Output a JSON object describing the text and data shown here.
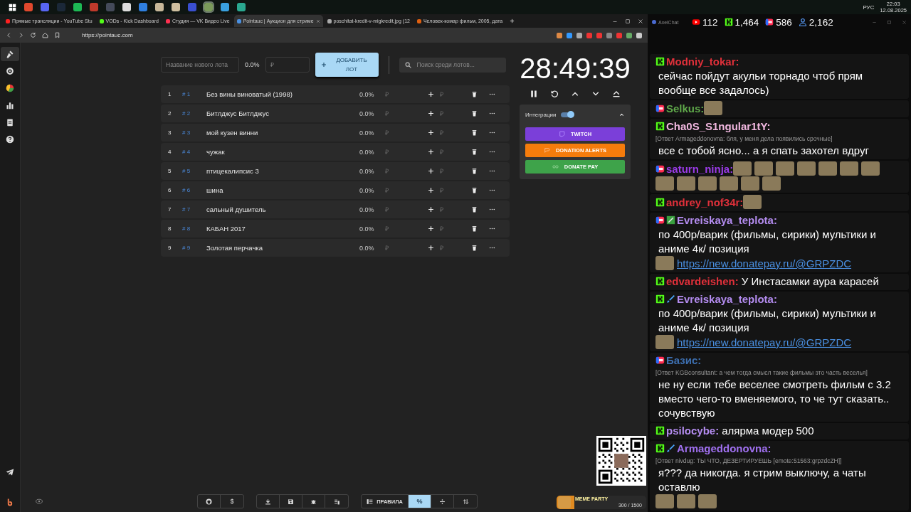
{
  "taskbar": {
    "apps": [
      {
        "color": "#e0482d",
        "selected": false
      },
      {
        "color": "#5865f2",
        "selected": false
      },
      {
        "color": "#1b2838",
        "selected": false
      },
      {
        "color": "#1db954",
        "selected": false
      },
      {
        "color": "#c0392b",
        "selected": false
      },
      {
        "color": "#444a5a",
        "selected": false
      },
      {
        "color": "#dddddd",
        "selected": false
      },
      {
        "color": "#2f7fe0",
        "selected": false
      },
      {
        "color": "#c8b89a",
        "selected": false
      },
      {
        "color": "#d0c0a0",
        "selected": false
      },
      {
        "color": "#3a4fd0",
        "selected": false
      },
      {
        "color": "#7a9a5a",
        "selected": true
      },
      {
        "color": "#3aa0e0",
        "selected": false
      },
      {
        "color": "#2aa890",
        "selected": false
      }
    ],
    "tray": {
      "language": "РУС",
      "time": "22:03",
      "date": "12.08.2025"
    }
  },
  "browser": {
    "tabs": [
      {
        "title": "Прямые трансляции - YouTube Stu",
        "color": "#ff2020",
        "selected": false
      },
      {
        "title": "VODs - Kick Dashboard",
        "color": "#53fc18",
        "selected": false
      },
      {
        "title": "Студия — VK Видео Live",
        "color": "#ff3050",
        "selected": false
      },
      {
        "title": "Pointauc | Аукцион для стриме",
        "color": "#4a90e2",
        "selected": true
      },
      {
        "title": "poschitat-kredit-v-migkredit.jpg (12",
        "color": "#aaaaaa",
        "selected": false
      },
      {
        "title": "Человек-комар фильм, 2005, дата",
        "color": "#e06010",
        "selected": false
      }
    ],
    "url": "https://pointauc.com"
  },
  "sidebar": {
    "items": [
      {
        "kind": "gavel",
        "selected": true
      },
      {
        "kind": "gear",
        "selected": false
      },
      {
        "kind": "pie",
        "selected": false
      },
      {
        "kind": "bars",
        "selected": false
      },
      {
        "kind": "clipboard",
        "selected": false
      },
      {
        "kind": "help",
        "selected": false
      }
    ],
    "bottom": [
      {
        "kind": "plane"
      },
      {
        "kind": "logo"
      }
    ]
  },
  "form": {
    "name_placeholder": "Название нового лота",
    "percent": "0.0%",
    "amount_placeholder": "₽",
    "add_button": "ДОБАВИТЬ ЛОТ",
    "search_placeholder": "Поиск среди лотов..."
  },
  "lots": [
    {
      "index": "1",
      "number": "# 1",
      "name": "Без вины виноватый (1998)",
      "percent": "0.0%",
      "amount_placeholder": "₽",
      "add_placeholder": "₽"
    },
    {
      "index": "2",
      "number": "# 2",
      "name": "Битлджус Битлджус",
      "percent": "0.0%",
      "amount_placeholder": "₽",
      "add_placeholder": "₽"
    },
    {
      "index": "3",
      "number": "# 3",
      "name": "мой кузен винни",
      "percent": "0.0%",
      "amount_placeholder": "₽",
      "add_placeholder": "₽"
    },
    {
      "index": "4",
      "number": "# 4",
      "name": "чужак",
      "percent": "0.0%",
      "amount_placeholder": "₽",
      "add_placeholder": "₽"
    },
    {
      "index": "5",
      "number": "# 5",
      "name": "птицекалипсис 3",
      "percent": "0.0%",
      "amount_placeholder": "₽",
      "add_placeholder": "₽"
    },
    {
      "index": "6",
      "number": "# 6",
      "name": "шина",
      "percent": "0.0%",
      "amount_placeholder": "₽",
      "add_placeholder": "₽"
    },
    {
      "index": "7",
      "number": "# 7",
      "name": "сальный душитель",
      "percent": "0.0%",
      "amount_placeholder": "₽",
      "add_placeholder": "₽"
    },
    {
      "index": "8",
      "number": "# 8",
      "name": "КАБАН 2017",
      "percent": "0.0%",
      "amount_placeholder": "₽",
      "add_placeholder": "₽"
    },
    {
      "index": "9",
      "number": "# 9",
      "name": "Золотая перчачка",
      "percent": "0.0%",
      "amount_placeholder": "₽",
      "add_placeholder": "₽"
    }
  ],
  "timer": {
    "time": "28:49:39",
    "controls": [
      {
        "kind": "pause"
      },
      {
        "kind": "restart"
      },
      {
        "kind": "up"
      },
      {
        "kind": "down"
      },
      {
        "kind": "eject"
      }
    ]
  },
  "integrations": {
    "label": "Интеграции",
    "on": true,
    "expanded": true,
    "buttons": [
      {
        "kind": "twitch",
        "label": "TWITCH",
        "color": "#7b3fd9"
      },
      {
        "kind": "alerts",
        "label": "DONATION ALERTS",
        "color": "#f57c0c"
      },
      {
        "kind": "donatepay",
        "label": "DONATE PAY",
        "color": "#3ea34a"
      }
    ]
  },
  "toolbar": {
    "groups": [
      [
        {
          "kind": "github",
          "selected": false
        },
        {
          "kind": "text",
          "label": "$",
          "selected": false
        }
      ],
      [
        {
          "kind": "download",
          "selected": false
        },
        {
          "kind": "save",
          "selected": false
        },
        {
          "kind": "bug",
          "selected": false
        },
        {
          "kind": "clear",
          "selected": false
        }
      ],
      [
        {
          "kind": "rules",
          "label": "ПРАВИЛА",
          "selected": false
        },
        {
          "kind": "text",
          "label": "%",
          "selected": true
        },
        {
          "kind": "divide",
          "selected": false
        },
        {
          "kind": "sort",
          "selected": false
        }
      ]
    ]
  },
  "overlay": {
    "meme_party": {
      "title": "MEME PARTY",
      "progress": "300 / 1500",
      "level": 0.2
    }
  },
  "chat": {
    "title": "AxelChat",
    "stats": [
      {
        "kind": "youtube",
        "value": "112"
      },
      {
        "kind": "kick",
        "value": "1,464"
      },
      {
        "kind": "vk",
        "value": "586"
      },
      {
        "kind": "viewers",
        "value": "2,162"
      }
    ],
    "messages": [
      {
        "kind": "kick",
        "author": "Modniy_tokar:",
        "color": "#e0303a",
        "parts": [
          {
            "kind": "text",
            "text": "сейчас пойдут акульи торнадо чтоб прям вообще все задалось)"
          }
        ]
      },
      {
        "kind": "vk",
        "author": "Selkus:",
        "color": "#5fa84a",
        "parts": [
          {
            "kind": "emote"
          }
        ]
      },
      {
        "kind": "kick",
        "author": "Cha0S_S1ngular1tY:",
        "color": "#f2b8e0",
        "reply": "[Ответ Armageddonovna: бля, у меня дела появились срочные]",
        "parts": [
          {
            "kind": "text",
            "text": "все с тобой ясно... а я спать захотел вдруг"
          }
        ]
      },
      {
        "kind": "vk",
        "author": "saturn_ninja:",
        "color": "#9b3be8",
        "parts": [
          {
            "kind": "emote"
          },
          {
            "kind": "emote"
          },
          {
            "kind": "emote"
          },
          {
            "kind": "emote"
          },
          {
            "kind": "emote"
          },
          {
            "kind": "emote"
          },
          {
            "kind": "emote"
          },
          {
            "kind": "emote"
          },
          {
            "kind": "emote"
          },
          {
            "kind": "emote"
          },
          {
            "kind": "emote"
          },
          {
            "kind": "emote"
          },
          {
            "kind": "emote"
          }
        ]
      },
      {
        "kind": "kick",
        "author": "andrey_nof34r:",
        "color": "#e0303a",
        "parts": [
          {
            "kind": "emote"
          }
        ]
      },
      {
        "kind": "vk",
        "badges": [
          {
            "kind": "pencil"
          }
        ],
        "author": "Evreiskaya_teplota:",
        "color": "#b48cf0",
        "parts": [
          {
            "kind": "text",
            "text": "по 400р/варик (фильмы, сирики) мультики и аниме 4к/ позиция"
          },
          {
            "kind": "emote"
          },
          {
            "kind": "link",
            "text": "https://new.donatepay.ru/@GRPZDC"
          }
        ]
      },
      {
        "kind": "kick",
        "author": "edvardeishen:",
        "color": "#e0303a",
        "parts": [
          {
            "kind": "text",
            "text": "У Инстасамки аура карасей"
          }
        ]
      },
      {
        "kind": "kick",
        "badges": [
          {
            "kind": "sword"
          }
        ],
        "author": "Evreiskaya_teplota:",
        "color": "#b48cf0",
        "parts": [
          {
            "kind": "text",
            "text": "по 400р/варик (фильмы, сирики) мультики и аниме 4к/ позиция"
          },
          {
            "kind": "emote"
          },
          {
            "kind": "link",
            "text": "https://new.donatepay.ru/@GRPZDC"
          }
        ]
      },
      {
        "kind": "vk",
        "author": "Базис:",
        "color": "#3d6fb0",
        "reply": "[Ответ KGBconsultant: а чем тогда смысл такие фильмы это часть веселья]",
        "parts": [
          {
            "kind": "text",
            "text": "не ну если тебе веселее смотреть фильм с 3.2 вместо чего-то вменяемого, то че тут сказать.. сочувствую"
          }
        ]
      },
      {
        "kind": "kick",
        "author": "psilocybe:",
        "color": "#b48cf0",
        "parts": [
          {
            "kind": "text",
            "text": "алярма модер 500"
          }
        ]
      },
      {
        "kind": "kick",
        "badges": [
          {
            "kind": "sword"
          }
        ],
        "author": "Armageddonovna:",
        "color": "#a070f0",
        "reply": "[Ответ nivdug: ТЫ ЧТО, ДЕЗЕРТИРУЕШЬ [emote:51563:grpzdcZH]]",
        "parts": [
          {
            "kind": "text",
            "text": "я??? да никогда. я стрим выключу, а чаты оставлю"
          },
          {
            "kind": "emote"
          },
          {
            "kind": "emote"
          },
          {
            "kind": "emote"
          }
        ]
      }
    ]
  }
}
